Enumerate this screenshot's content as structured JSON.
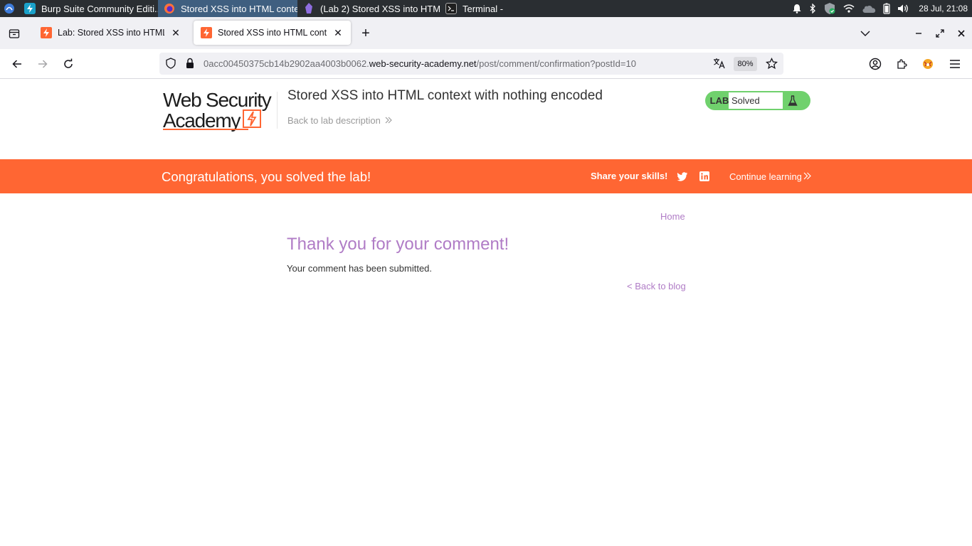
{
  "taskbar": {
    "tasks": [
      {
        "label": "Burp Suite Community Editi...",
        "icon": "burp-icon"
      },
      {
        "label": "Stored XSS into HTML conte...",
        "icon": "firefox-icon",
        "active": true
      },
      {
        "label": "(Lab 2) Stored XSS into HTM...",
        "icon": "obsidian-icon"
      },
      {
        "label": "Terminal -",
        "icon": "terminal-icon"
      }
    ],
    "clock": "28 Jul, 21:08"
  },
  "browser": {
    "tabs": [
      {
        "title": "Lab: Stored XSS into HTML context with nothing encoded",
        "active": false
      },
      {
        "title": "Stored XSS into HTML context with nothing encoded",
        "active": true
      }
    ],
    "url_prefix": "0acc00450375cb14b2902aa4003b0062.",
    "url_host": "web-security-academy.net",
    "url_path": "/post/comment/confirmation?postId=10",
    "zoom": "80%"
  },
  "header": {
    "logo_line1": "Web Security",
    "logo_line2": "Academy",
    "lab_title": "Stored XSS into HTML context with nothing encoded",
    "back_to_description": "Back to lab description",
    "status_label": "LAB",
    "status_value": "Solved"
  },
  "banner": {
    "message": "Congratulations, you solved the lab!",
    "share": "Share your skills!",
    "continue": "Continue learning"
  },
  "main": {
    "home": "Home",
    "heading": "Thank you for your comment!",
    "body": "Your comment has been submitted.",
    "back": "< Back to blog"
  },
  "colors": {
    "accent_orange": "#ff6633",
    "link_purple": "#b07cc6",
    "solved_green": "#70d16d"
  }
}
